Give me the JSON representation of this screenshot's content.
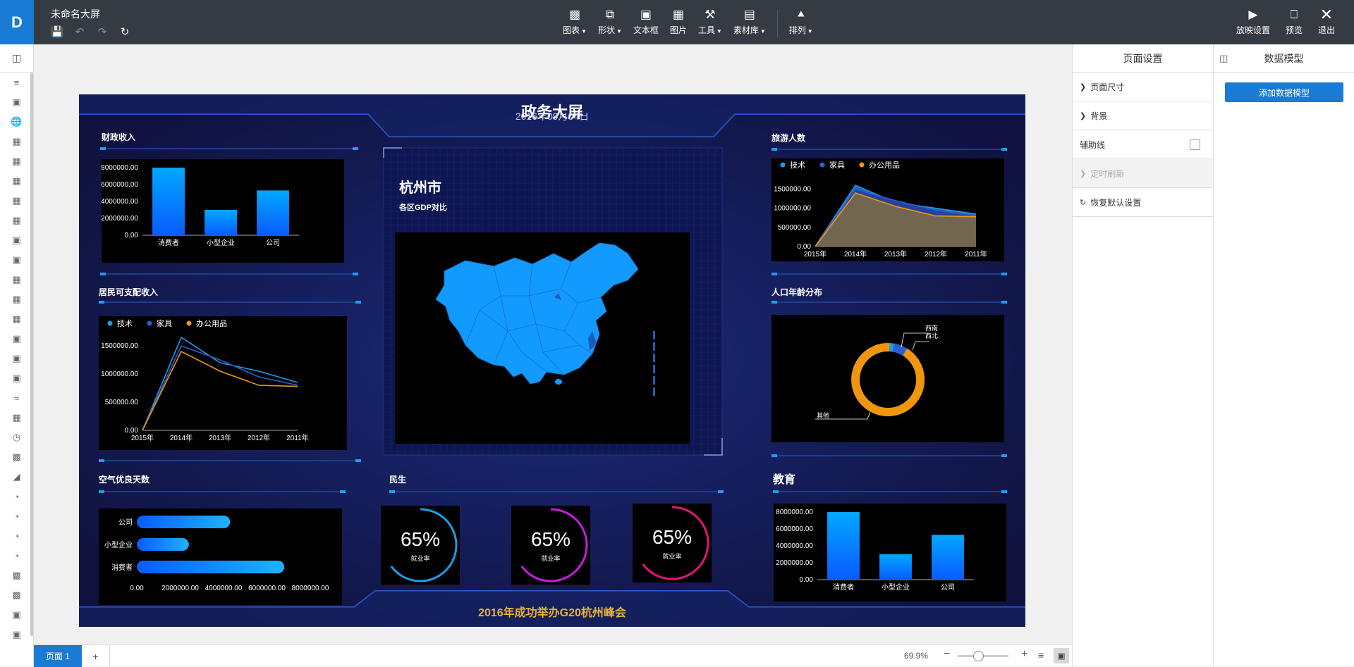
{
  "app": {
    "logo": "D",
    "doc_title": "未命名大屏"
  },
  "toolbar": {
    "tools": [
      {
        "label": "图表",
        "icon": "chart-icon",
        "caret": true
      },
      {
        "label": "形状",
        "icon": "shape-icon",
        "caret": true
      },
      {
        "label": "文本框",
        "icon": "textbox-icon",
        "caret": false
      },
      {
        "label": "图片",
        "icon": "image-icon",
        "caret": false
      },
      {
        "label": "工具",
        "icon": "tools-icon",
        "caret": true
      },
      {
        "label": "素材库",
        "icon": "library-icon",
        "caret": true
      },
      {
        "label": "排列",
        "icon": "arrange-icon",
        "caret": true
      }
    ],
    "right": [
      {
        "label": "放映设置",
        "icon": "play-icon"
      },
      {
        "label": "预览",
        "icon": "preview-icon"
      },
      {
        "label": "退出",
        "icon": "exit-icon"
      }
    ]
  },
  "screen": {
    "title": "政务大屏",
    "subtitle": "2016年09月04日",
    "footer": "2016年成功举办G20杭州峰会",
    "panels": {
      "fiscal": {
        "title": "财政收入"
      },
      "income": {
        "title": "居民可支配收入"
      },
      "air": {
        "title": "空气优良天数"
      },
      "tourism": {
        "title": "旅游人数"
      },
      "age": {
        "title": "人口年龄分布"
      },
      "education": {
        "title": "教育"
      },
      "livelihood": {
        "title": "民生"
      },
      "map": {
        "city": "杭州市",
        "subtitle": "各区GDP对比"
      }
    },
    "gauges": [
      {
        "value": "65%",
        "label": "就业率",
        "color": "#1e9be8"
      },
      {
        "value": "65%",
        "label": "就业率",
        "color": "#c51ce0"
      },
      {
        "value": "65%",
        "label": "就业率",
        "color": "#e0157a"
      }
    ]
  },
  "chart_data": [
    {
      "id": "fiscal",
      "type": "bar",
      "categories": [
        "消费者",
        "小型企业",
        "公司"
      ],
      "values": [
        8000000,
        3000000,
        5300000
      ],
      "yticks": [
        "8000000.00",
        "6000000.00",
        "4000000.00",
        "2000000.00",
        "0.00"
      ],
      "ylim": [
        0,
        8000000
      ]
    },
    {
      "id": "income",
      "type": "line",
      "categories": [
        "2015年",
        "2014年",
        "2013年",
        "2012年",
        "2011年"
      ],
      "yticks": [
        "1500000.00",
        "1000000.00",
        "500000.00",
        "0.00"
      ],
      "ylim": [
        0,
        1750000
      ],
      "series": [
        {
          "name": "技术",
          "values": [
            0,
            1650000,
            1200000,
            1050000,
            850000
          ],
          "color": "#1e9be8"
        },
        {
          "name": "家具",
          "values": [
            0,
            1500000,
            1250000,
            950000,
            800000
          ],
          "color": "#2b5fd6"
        },
        {
          "name": "办公用品",
          "values": [
            0,
            1400000,
            1050000,
            800000,
            780000
          ],
          "color": "#f0960e"
        }
      ]
    },
    {
      "id": "air",
      "type": "bar",
      "orientation": "horizontal",
      "categories": [
        "公司",
        "小型企业",
        "消费者"
      ],
      "values": [
        4300000,
        2400000,
        6800000
      ],
      "xticks": [
        "0.00",
        "2000000.00",
        "4000000.00",
        "6000000.00",
        "8000000.00"
      ],
      "xlim": [
        0,
        8000000
      ]
    },
    {
      "id": "tourism",
      "type": "area",
      "categories": [
        "2015年",
        "2014年",
        "2013年",
        "2012年",
        "2011年"
      ],
      "yticks": [
        "1500000.00",
        "1000000.00",
        "500000.00",
        "0.00"
      ],
      "ylim": [
        0,
        1750000
      ],
      "series": [
        {
          "name": "技术",
          "values": [
            0,
            1600000,
            1150000,
            1000000,
            850000
          ],
          "color": "#1e9be8"
        },
        {
          "name": "家具",
          "values": [
            0,
            1500000,
            1200000,
            950000,
            800000
          ],
          "color": "#2b5fd6"
        },
        {
          "name": "办公用品",
          "values": [
            0,
            1400000,
            1050000,
            800000,
            780000
          ],
          "color": "#f0960e"
        }
      ]
    },
    {
      "id": "age",
      "type": "pie",
      "labels": [
        "西南",
        "西北",
        "其他"
      ],
      "values": [
        2,
        6,
        92
      ],
      "colors": [
        "#1e9be8",
        "#2b5fd6",
        "#f0960e"
      ]
    },
    {
      "id": "education",
      "type": "bar",
      "categories": [
        "消费者",
        "小型企业",
        "公司"
      ],
      "values": [
        8000000,
        3000000,
        5300000
      ],
      "yticks": [
        "8000000.00",
        "6000000.00",
        "4000000.00",
        "2000000.00",
        "0.00"
      ],
      "ylim": [
        0,
        8000000
      ]
    }
  ],
  "right_panel": {
    "tab_page": "页面设置",
    "tab_model": "数据模型",
    "rows": [
      "页面尺寸",
      "背景",
      "辅助线",
      "定时刷新",
      "恢复默认设置"
    ],
    "add_model": "添加数据模型"
  },
  "bottom": {
    "page_tab": "页面 1",
    "add": "+",
    "zoom": "69.9%"
  }
}
